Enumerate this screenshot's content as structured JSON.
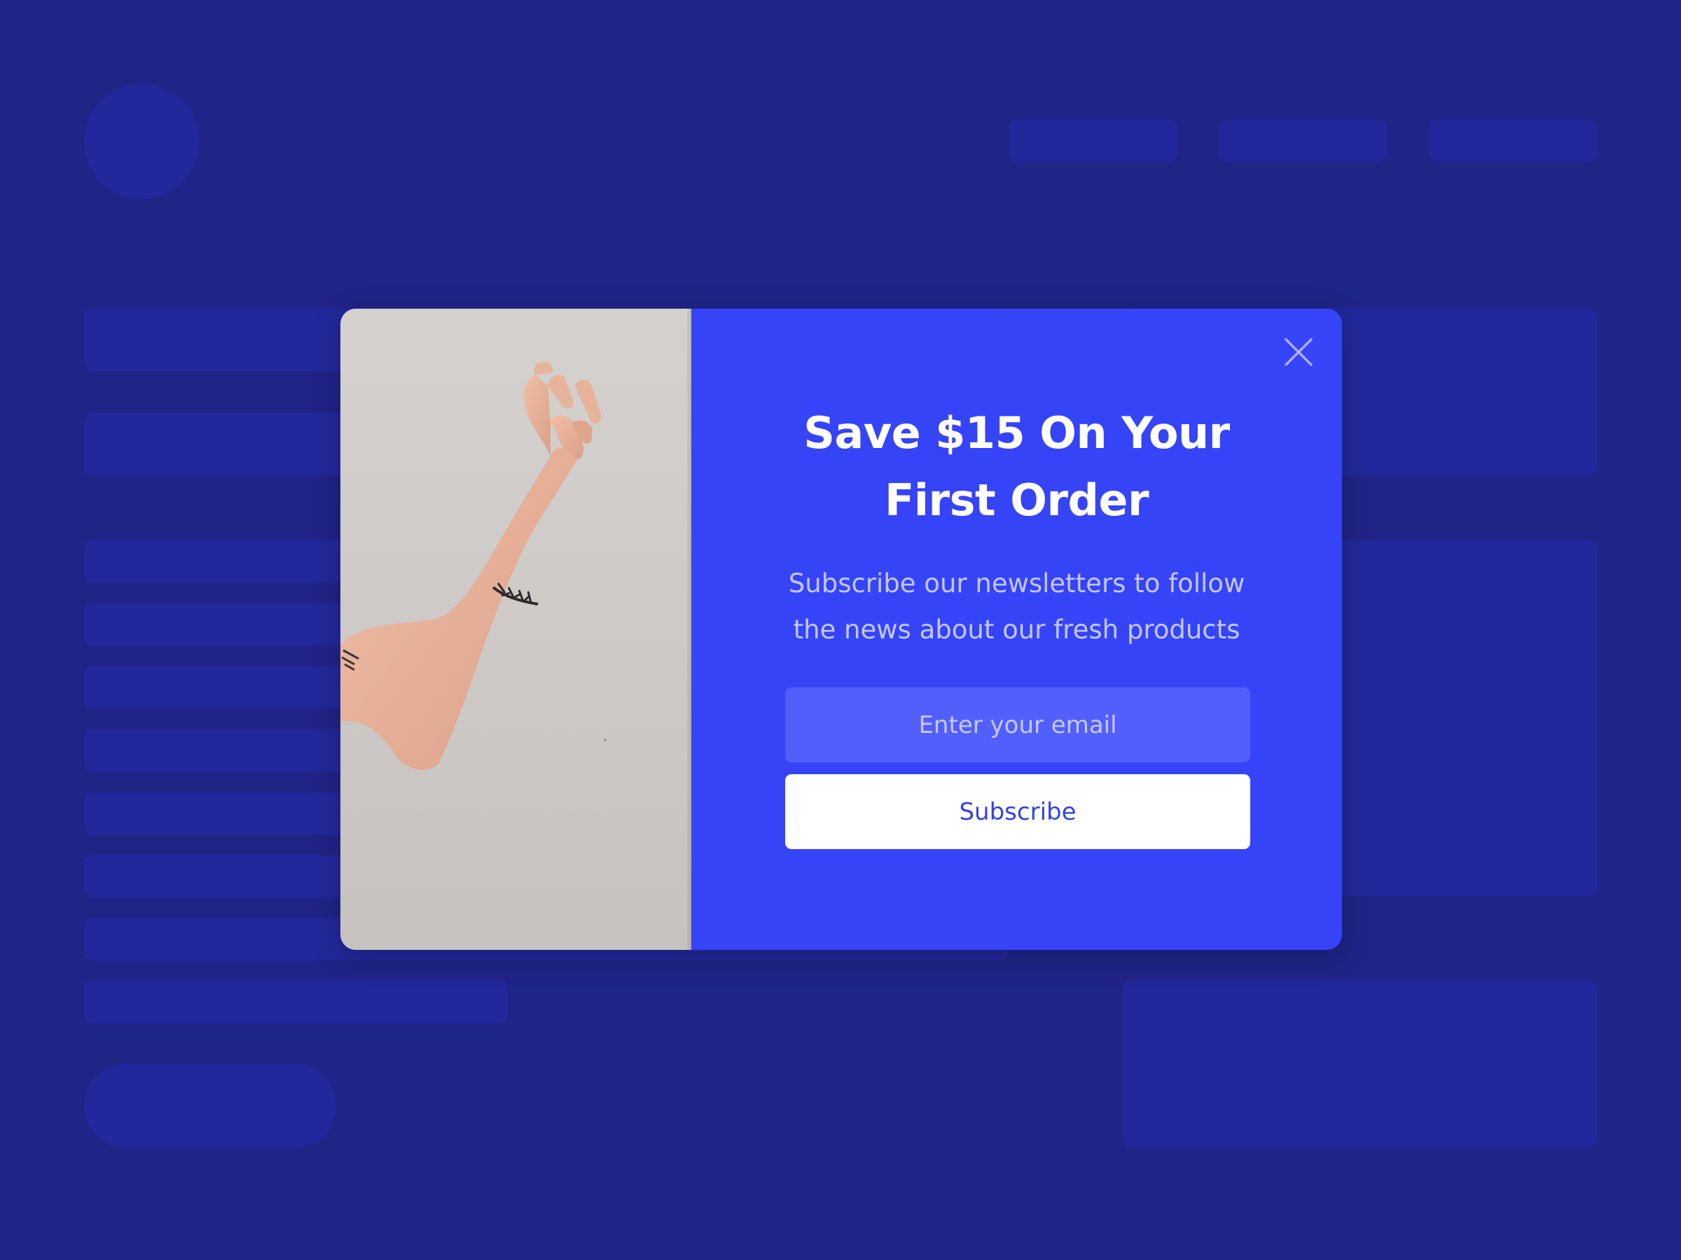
{
  "popup": {
    "headline_line1": "Save $15 On Your",
    "headline_line2": "First Order",
    "subtext_line1": "Subscribe our newsletters to follow",
    "subtext_line2": "the news about our fresh products",
    "email_placeholder": "Enter your email",
    "subscribe_label": "Subscribe",
    "close_icon": "close-icon",
    "image": "arm-with-tattoo-photo"
  },
  "colors": {
    "page_background": "#1f2487",
    "placeholder_blocks": "#22289b",
    "popup_background": "#3644f8",
    "email_field": "#535ffb",
    "subscribe_button": "#ffffff",
    "subscribe_text": "#3341e6"
  }
}
